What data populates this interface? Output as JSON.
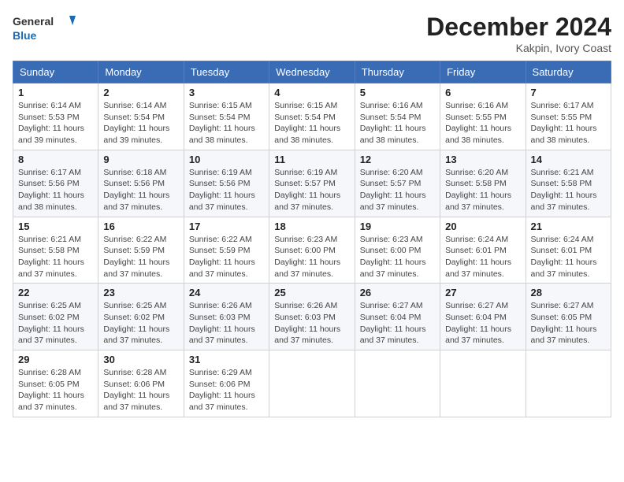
{
  "logo": {
    "line1": "General",
    "line2": "Blue"
  },
  "title": "December 2024",
  "location": "Kakpin, Ivory Coast",
  "weekdays": [
    "Sunday",
    "Monday",
    "Tuesday",
    "Wednesday",
    "Thursday",
    "Friday",
    "Saturday"
  ],
  "weeks": [
    [
      {
        "day": "1",
        "sunrise": "6:14 AM",
        "sunset": "5:53 PM",
        "daylight": "11 hours and 39 minutes."
      },
      {
        "day": "2",
        "sunrise": "6:14 AM",
        "sunset": "5:54 PM",
        "daylight": "11 hours and 39 minutes."
      },
      {
        "day": "3",
        "sunrise": "6:15 AM",
        "sunset": "5:54 PM",
        "daylight": "11 hours and 38 minutes."
      },
      {
        "day": "4",
        "sunrise": "6:15 AM",
        "sunset": "5:54 PM",
        "daylight": "11 hours and 38 minutes."
      },
      {
        "day": "5",
        "sunrise": "6:16 AM",
        "sunset": "5:54 PM",
        "daylight": "11 hours and 38 minutes."
      },
      {
        "day": "6",
        "sunrise": "6:16 AM",
        "sunset": "5:55 PM",
        "daylight": "11 hours and 38 minutes."
      },
      {
        "day": "7",
        "sunrise": "6:17 AM",
        "sunset": "5:55 PM",
        "daylight": "11 hours and 38 minutes."
      }
    ],
    [
      {
        "day": "8",
        "sunrise": "6:17 AM",
        "sunset": "5:56 PM",
        "daylight": "11 hours and 38 minutes."
      },
      {
        "day": "9",
        "sunrise": "6:18 AM",
        "sunset": "5:56 PM",
        "daylight": "11 hours and 37 minutes."
      },
      {
        "day": "10",
        "sunrise": "6:19 AM",
        "sunset": "5:56 PM",
        "daylight": "11 hours and 37 minutes."
      },
      {
        "day": "11",
        "sunrise": "6:19 AM",
        "sunset": "5:57 PM",
        "daylight": "11 hours and 37 minutes."
      },
      {
        "day": "12",
        "sunrise": "6:20 AM",
        "sunset": "5:57 PM",
        "daylight": "11 hours and 37 minutes."
      },
      {
        "day": "13",
        "sunrise": "6:20 AM",
        "sunset": "5:58 PM",
        "daylight": "11 hours and 37 minutes."
      },
      {
        "day": "14",
        "sunrise": "6:21 AM",
        "sunset": "5:58 PM",
        "daylight": "11 hours and 37 minutes."
      }
    ],
    [
      {
        "day": "15",
        "sunrise": "6:21 AM",
        "sunset": "5:58 PM",
        "daylight": "11 hours and 37 minutes."
      },
      {
        "day": "16",
        "sunrise": "6:22 AM",
        "sunset": "5:59 PM",
        "daylight": "11 hours and 37 minutes."
      },
      {
        "day": "17",
        "sunrise": "6:22 AM",
        "sunset": "5:59 PM",
        "daylight": "11 hours and 37 minutes."
      },
      {
        "day": "18",
        "sunrise": "6:23 AM",
        "sunset": "6:00 PM",
        "daylight": "11 hours and 37 minutes."
      },
      {
        "day": "19",
        "sunrise": "6:23 AM",
        "sunset": "6:00 PM",
        "daylight": "11 hours and 37 minutes."
      },
      {
        "day": "20",
        "sunrise": "6:24 AM",
        "sunset": "6:01 PM",
        "daylight": "11 hours and 37 minutes."
      },
      {
        "day": "21",
        "sunrise": "6:24 AM",
        "sunset": "6:01 PM",
        "daylight": "11 hours and 37 minutes."
      }
    ],
    [
      {
        "day": "22",
        "sunrise": "6:25 AM",
        "sunset": "6:02 PM",
        "daylight": "11 hours and 37 minutes."
      },
      {
        "day": "23",
        "sunrise": "6:25 AM",
        "sunset": "6:02 PM",
        "daylight": "11 hours and 37 minutes."
      },
      {
        "day": "24",
        "sunrise": "6:26 AM",
        "sunset": "6:03 PM",
        "daylight": "11 hours and 37 minutes."
      },
      {
        "day": "25",
        "sunrise": "6:26 AM",
        "sunset": "6:03 PM",
        "daylight": "11 hours and 37 minutes."
      },
      {
        "day": "26",
        "sunrise": "6:27 AM",
        "sunset": "6:04 PM",
        "daylight": "11 hours and 37 minutes."
      },
      {
        "day": "27",
        "sunrise": "6:27 AM",
        "sunset": "6:04 PM",
        "daylight": "11 hours and 37 minutes."
      },
      {
        "day": "28",
        "sunrise": "6:27 AM",
        "sunset": "6:05 PM",
        "daylight": "11 hours and 37 minutes."
      }
    ],
    [
      {
        "day": "29",
        "sunrise": "6:28 AM",
        "sunset": "6:05 PM",
        "daylight": "11 hours and 37 minutes."
      },
      {
        "day": "30",
        "sunrise": "6:28 AM",
        "sunset": "6:06 PM",
        "daylight": "11 hours and 37 minutes."
      },
      {
        "day": "31",
        "sunrise": "6:29 AM",
        "sunset": "6:06 PM",
        "daylight": "11 hours and 37 minutes."
      },
      null,
      null,
      null,
      null
    ]
  ],
  "labels": {
    "sunrise": "Sunrise:",
    "sunset": "Sunset:",
    "daylight": "Daylight:"
  }
}
